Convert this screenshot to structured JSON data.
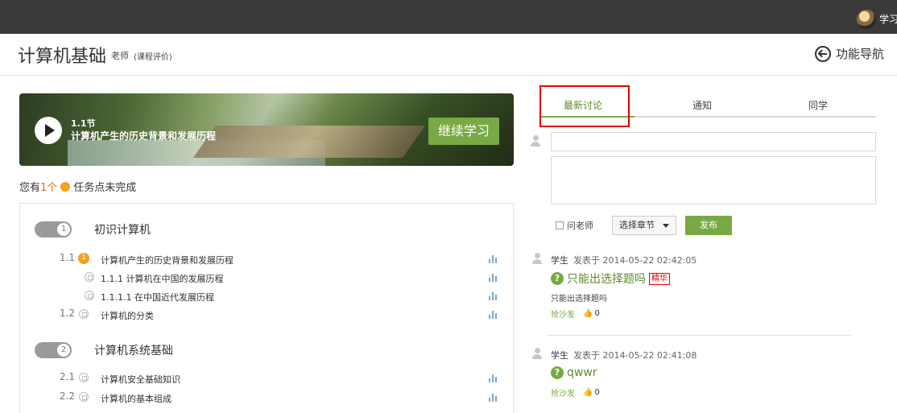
{
  "topbar": {
    "user_label": "学习"
  },
  "header": {
    "course_title": "计算机基础",
    "teacher": "老师",
    "evaluation_link": "(课程评价)",
    "nav_label": "功能导航"
  },
  "banner": {
    "section_no": "1.1节",
    "section_title": "计算机产生的历史背景和发展历程",
    "continue_label": "继续学习"
  },
  "tasks": {
    "prefix": "您有",
    "count": "1个",
    "suffix": "任务点未完成"
  },
  "outline": {
    "chapters": [
      {
        "num": "1",
        "title": "初识计算机"
      },
      {
        "num": "2",
        "title": "计算机系统基础"
      }
    ],
    "rows": [
      {
        "no": "1.1",
        "status": "current",
        "status_text": "1",
        "title": "计算机产生的历史背景和发展历程"
      },
      {
        "no": "",
        "status": "locked",
        "title": "1.1.1 计算机在中国的发展历程"
      },
      {
        "no": "",
        "status": "locked",
        "title": "1.1.1.1 在中国近代发展历程"
      },
      {
        "no": "1.2",
        "status": "locked",
        "title": "计算机的分类"
      },
      {
        "no": "2.1",
        "status": "locked",
        "title": "计算机安全基础知识"
      },
      {
        "no": "2.2",
        "status": "locked",
        "title": "计算机的基本组成"
      }
    ]
  },
  "tabs": [
    {
      "label": "最新讨论",
      "active": true
    },
    {
      "label": "通知",
      "active": false
    },
    {
      "label": "同学",
      "active": false
    }
  ],
  "compose": {
    "title_value": "",
    "body_value": "",
    "ask_teacher_label": "问老师",
    "chapter_select": "选择章节",
    "publish_label": "发布"
  },
  "posts": [
    {
      "author": "学生",
      "posted": "发表于 2014-05-22 02:42:05",
      "question": "只能出选择题吗",
      "badge": "精华",
      "body": "只能出选择题吗",
      "reply_label": "抢沙发",
      "likes": "0"
    },
    {
      "author": "学生",
      "posted": "发表于 2014-05-22 02:41:08",
      "question": "qwwr",
      "badge": "",
      "body": "",
      "reply_label": "抢沙发",
      "likes": "0"
    }
  ],
  "colors": {
    "accent": "#79a945",
    "warning": "#f5a11c",
    "highlight": "#e00000"
  }
}
